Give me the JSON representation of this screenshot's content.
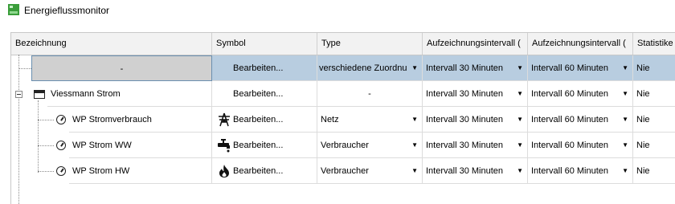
{
  "window": {
    "title": "Energieflussmonitor"
  },
  "columns": [
    "Bezeichnung",
    "Symbol",
    "Type",
    "Aufzeichnungsintervall (",
    "Aufzeichnungsintervall (",
    "Statistike"
  ],
  "rows": [
    {
      "name": "-",
      "symbol": "Bearbeiten...",
      "type": "verschiedene Zuordnu",
      "interval1": "Intervall 30 Minuten",
      "interval2": "Intervall 60 Minuten",
      "stat": "Nie"
    },
    {
      "name": "Viessmann Strom",
      "symbol": "Bearbeiten...",
      "type": "-",
      "interval1": "Intervall 30 Minuten",
      "interval2": "Intervall 60 Minuten",
      "stat": "Nie"
    },
    {
      "name": "WP Stromverbrauch",
      "symbol": "Bearbeiten...",
      "type": "Netz",
      "interval1": "Intervall 30 Minuten",
      "interval2": "Intervall 60 Minuten",
      "stat": "Nie",
      "icon": "power-tower-icon"
    },
    {
      "name": "WP Strom WW",
      "symbol": "Bearbeiten...",
      "type": "Verbraucher",
      "interval1": "Intervall 30 Minuten",
      "interval2": "Intervall 60 Minuten",
      "stat": "Nie",
      "icon": "faucet-icon"
    },
    {
      "name": "WP Strom HW",
      "symbol": "Bearbeiten...",
      "type": "Verbraucher",
      "interval1": "Intervall 30 Minuten",
      "interval2": "Intervall 60 Minuten",
      "stat": "Nie",
      "icon": "flame-icon"
    }
  ]
}
